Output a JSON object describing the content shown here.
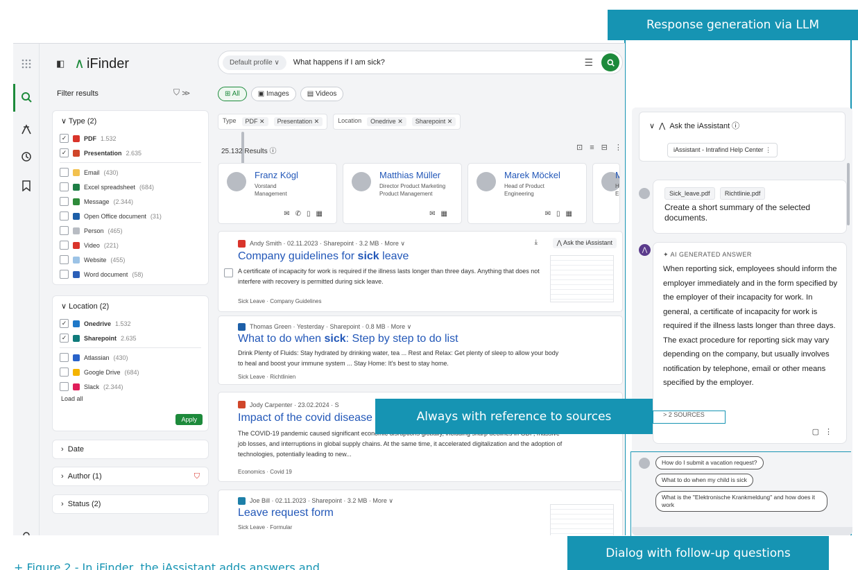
{
  "callouts": {
    "top": "Response generation via LLM",
    "sources": "Always with reference to sources",
    "dialog": "Dialog with follow-up questions"
  },
  "caption": "+  Figure 2 - In iFinder, the iAssistant adds answers and",
  "brand": {
    "name": "iFinder"
  },
  "search": {
    "profile": "Default profile ∨",
    "query": "What happens if I am sick?"
  },
  "filters": {
    "title": "Filter results",
    "type": {
      "header": "Type (2)",
      "selected": [
        {
          "label": "PDF",
          "count": "1.532",
          "color": "#d9342b"
        },
        {
          "label": "Presentation",
          "count": "2.635",
          "color": "#d0462a"
        }
      ],
      "items": [
        {
          "label": "Email",
          "count": "(430)",
          "color": "#f2c14e"
        },
        {
          "label": "Excel spreadsheet",
          "count": "(684)",
          "color": "#1e7e45"
        },
        {
          "label": "Message",
          "count": "(2.344)",
          "color": "#2e8b3a"
        },
        {
          "label": "Open Office document",
          "count": "(31)",
          "color": "#1d5fa8"
        },
        {
          "label": "Person",
          "count": "(465)",
          "color": "#b8bcc3"
        },
        {
          "label": "Video",
          "count": "(221)",
          "color": "#d9342b"
        },
        {
          "label": "Website",
          "count": "(455)",
          "color": "#9cc3e6"
        },
        {
          "label": "Word document",
          "count": "(58)",
          "color": "#2b5fb8"
        }
      ]
    },
    "location": {
      "header": "Location (2)",
      "selected": [
        {
          "label": "Onedrive",
          "count": "1.532",
          "color": "#1f78c8"
        },
        {
          "label": "Sharepoint",
          "count": "2.635",
          "color": "#0f7b7b"
        }
      ],
      "items": [
        {
          "label": "Atlassian",
          "count": "(430)",
          "color": "#2862c9"
        },
        {
          "label": "Google Drive",
          "count": "(684)",
          "color": "#f4b400"
        },
        {
          "label": "Slack",
          "count": "(2.344)",
          "color": "#e01e5a"
        }
      ],
      "load_all": "Load all",
      "apply": "Apply"
    },
    "date": "Date",
    "author": "Author (1)",
    "status": "Status (2)"
  },
  "tabs": [
    "All",
    "Images",
    "Videos"
  ],
  "active_chips": {
    "type_label": "Type",
    "type": [
      "PDF ✕",
      "Presentation ✕"
    ],
    "location_label": "Location",
    "location": [
      "Onedrive ✕",
      "Sharepoint ✕"
    ]
  },
  "results_count": "25.132 Results ⓘ",
  "people": [
    {
      "name": "Franz Kögl",
      "role1": "Vorstand",
      "role2": "Management"
    },
    {
      "name": "Matthias Müller",
      "role1": "Director Product Marketing",
      "role2": "Product Management"
    },
    {
      "name": "Marek Möckel",
      "role1": "Head of Product",
      "role2": "Engineering"
    },
    {
      "name": "M",
      "role1": "He",
      "role2": "En"
    }
  ],
  "results": [
    {
      "meta": "Andy Smith · 02.11.2023 · Sharepoint · 3.2 MB · More ∨",
      "title_pre": "Company guidelines for ",
      "title_bold": "sick",
      "title_post": " leave",
      "snippet": "A certificate of incapacity for work is required if the illness lasts longer than three days. Anything that does not interfere with recovery is permitted during sick leave.",
      "tags": "Sick Leave · Company Guidelines",
      "ask": "Ask the iAssistant",
      "icon_color": "#d9342b"
    },
    {
      "meta": "Thomas Green · Yesterday · Sharepoint · 0.8 MB · More ∨",
      "title_pre": "What to do when ",
      "title_bold": "sick",
      "title_post": ": Step by step to do list",
      "snippet": "Drink Plenty of Fluids: Stay hydrated by drinking water, tea ... Rest and Relax: Get plenty of sleep to allow your body to heal and boost your immune system ... Stay Home: It's best to stay home.",
      "tags": "Sick Leave · Richtlinien",
      "icon_color": "#1d5fa8"
    },
    {
      "meta": "Jody Carpenter · 23.02.2024 · S",
      "title_pre": "Impact of the covid disease",
      "title_bold": "",
      "title_post": "",
      "snippet": "The COVID-19 pandemic caused significant economic disruptions globally, including sharp declines in GDP, massive job losses, and interruptions in global supply chains. At the same time, it accelerated digitalization and the adoption of technologies, potentially leading to new...",
      "tags": "Economics · Covid 19",
      "icon_color": "#d0462a"
    },
    {
      "meta": "Joe Bill · 02.11.2023 · Sharepoint · 3.2 MB · More ∨",
      "title_pre": "Leave request form",
      "title_bold": "",
      "title_post": "",
      "tags": "Sick Leave · Formular",
      "icon_color": "#1d7fa8"
    }
  ],
  "assistant": {
    "title": "Ask the iAssistant ⓘ",
    "help_chip": "iAssistant - Intrafind Help Center  ⋮",
    "user_docs": [
      "Sick_leave.pdf",
      "Richtlinie.pdf"
    ],
    "user_text": "Create a short summary of the selected documents.",
    "ai_label": "✦ AI GENERATED ANSWER",
    "ai_text": "When reporting sick, employees should inform the employer immediately and in the form specified by the employer of their incapacity for work. In general, a certificate of incapacity for work is required if the illness lasts longer than three days. The exact procedure for reporting sick may vary depending on the company, but usually involves notification by telephone, email or other means specified by the employer.",
    "sources": "> 2 SOURCES",
    "followups": [
      "How do I submit a vacation request?",
      "What to do when my child is sick",
      "What is the \"Elektronische Krankmeldung\" and how does it work"
    ]
  }
}
